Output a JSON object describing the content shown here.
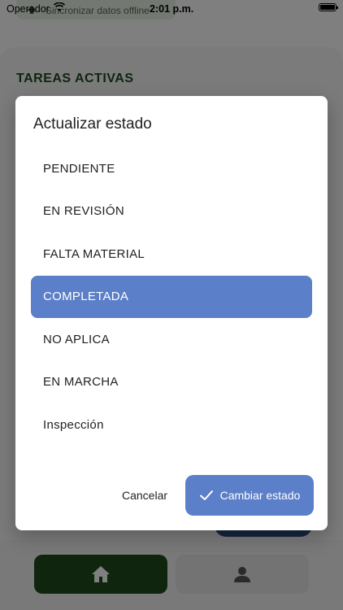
{
  "status_bar": {
    "carrier": "Operador",
    "time": "2:01 p.m."
  },
  "background": {
    "sync_label": "Sincronizar datos offline",
    "section_title": "TAREAS ACTIVAS",
    "nav": {
      "home_icon": "home-icon",
      "profile_icon": "person-icon"
    }
  },
  "dialog": {
    "title": "Actualizar estado",
    "options": [
      {
        "label": "PENDIENTE"
      },
      {
        "label": "EN REVISIÓN"
      },
      {
        "label": "FALTA MATERIAL"
      },
      {
        "label": "COMPLETADA"
      },
      {
        "label": "NO APLICA"
      },
      {
        "label": "EN MARCHA"
      },
      {
        "label": "Inspección"
      }
    ],
    "selected": "COMPLETADA",
    "cancel_label": "Cancelar",
    "confirm_label": "Cambiar estado",
    "confirm_icon": "check-icon"
  },
  "colors": {
    "accent": "#5b7fc8",
    "brand_green": "#1f4a1c"
  }
}
